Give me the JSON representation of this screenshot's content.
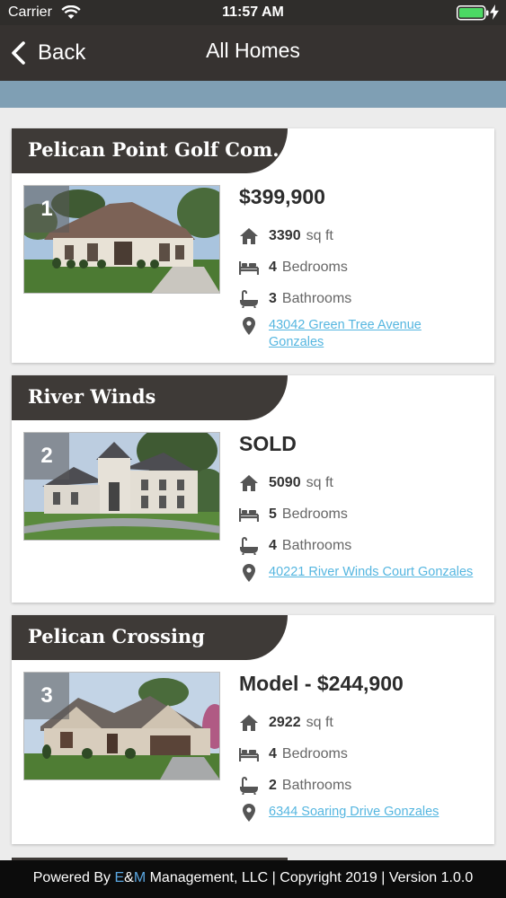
{
  "status": {
    "carrier": "Carrier",
    "time": "11:57 AM"
  },
  "nav": {
    "back_label": "Back",
    "title": "All Homes"
  },
  "homes": [
    {
      "name": "Pelican Point Golf Com…",
      "number": "1",
      "price": "$399,900",
      "sqft": "3390",
      "sqft_unit": "sq ft",
      "bedrooms": "4",
      "bedrooms_label": "Bedrooms",
      "bathrooms": "3",
      "bathrooms_label": "Bathrooms",
      "address": "43042 Green Tree Avenue Gonzales"
    },
    {
      "name": "River Winds",
      "number": "2",
      "price": "SOLD",
      "sqft": "5090",
      "sqft_unit": "sq ft",
      "bedrooms": "5",
      "bedrooms_label": "Bedrooms",
      "bathrooms": "4",
      "bathrooms_label": "Bathrooms",
      "address": "40221 River Winds Court Gonzales"
    },
    {
      "name": "Pelican Crossing",
      "number": "3",
      "price": "Model - $244,900",
      "sqft": "2922",
      "sqft_unit": "sq ft",
      "bedrooms": "4",
      "bedrooms_label": "Bedrooms",
      "bathrooms": "2",
      "bathrooms_label": "Bathrooms",
      "address": "6344 Soaring Drive Gonzales"
    }
  ],
  "footer": {
    "prefix": "Powered By ",
    "brand_e": "E",
    "brand_amp": "&",
    "brand_m": "M",
    "suffix": " Management, LLC | Copyright 2019 | Version 1.0.0"
  },
  "colors": {
    "nav_background": "#363230",
    "sub_bar": "#7f9fb4",
    "card_tab": "#3e3a37",
    "link": "#55b6e0",
    "footer_brand": "#5aa6e0"
  }
}
